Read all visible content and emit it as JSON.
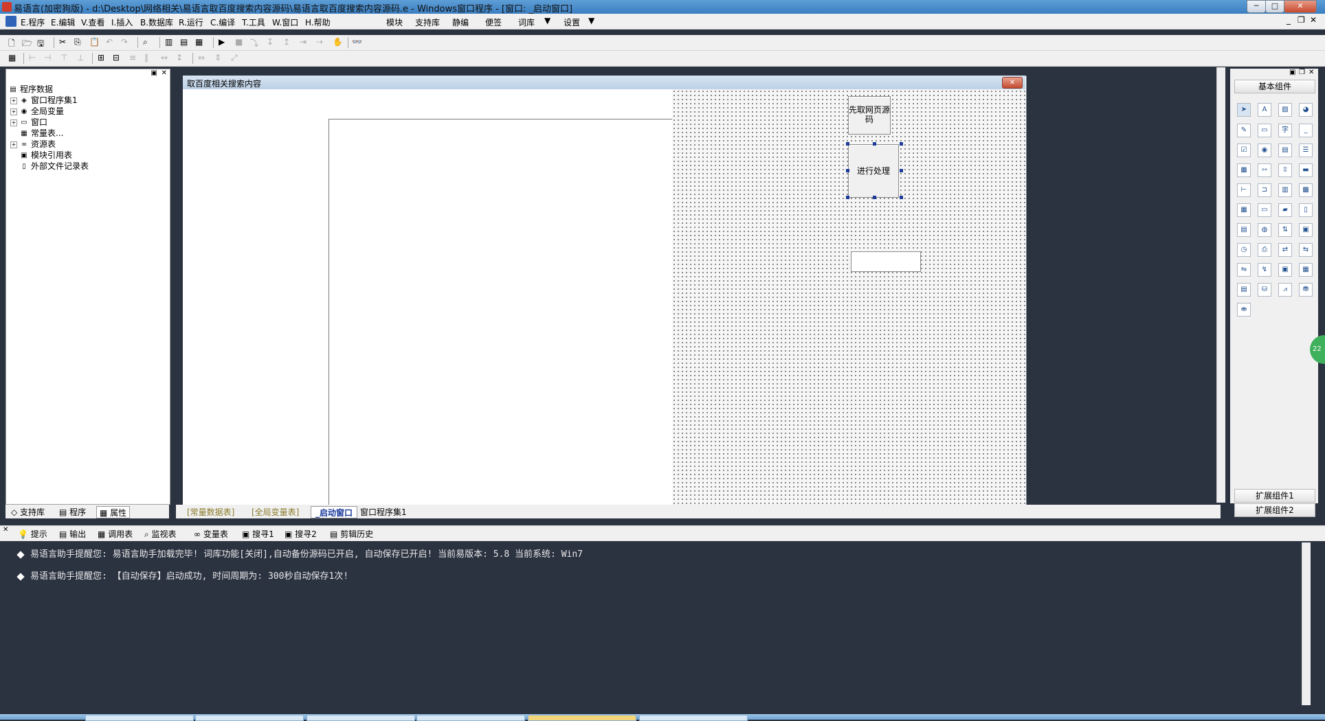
{
  "titlebar": {
    "title": "易语言(加密狗版) - d:\\Desktop\\网络相关\\易语言取百度搜索内容源码\\易语言取百度搜索内容源码.e - Windows窗口程序 - [窗口: _启动窗口]",
    "minimize": "─",
    "maximize": "□",
    "close": "✕"
  },
  "menubar": {
    "items": [
      "E.程序",
      "E.编辑",
      "V.查看",
      "I.插入",
      "B.数据库",
      "R.运行",
      "C.编译",
      "T.工具",
      "W.窗口",
      "H.帮助"
    ],
    "extras": [
      "模块",
      "支持库",
      "静编",
      "便签",
      "词库",
      "设置"
    ]
  },
  "left_panel": {
    "tree": [
      {
        "label": "程序数据",
        "expand": ""
      },
      {
        "label": "窗口程序集1",
        "expand": "+"
      },
      {
        "label": "全局变量",
        "expand": "+"
      },
      {
        "label": "窗口",
        "expand": "+"
      },
      {
        "label": "常量表...",
        "expand": ""
      },
      {
        "label": "资源表",
        "expand": "+"
      },
      {
        "label": "模块引用表",
        "expand": ""
      },
      {
        "label": "外部文件记录表",
        "expand": ""
      }
    ],
    "tabs": [
      "支持库",
      "程序",
      "属性"
    ]
  },
  "design": {
    "window_title": "取百度相关搜索内容",
    "button1": "先取网页源码",
    "button2": "进行处理",
    "tabs": [
      "[常量数据表]",
      "[全局变量表]",
      "_启动窗口",
      "窗口程序集1"
    ]
  },
  "right_panel": {
    "header": "基本组件",
    "ext1": "扩展组件1",
    "ext2": "扩展组件2",
    "side_badge": "22"
  },
  "output_tabs": [
    "提示",
    "输出",
    "调用表",
    "监视表",
    "变量表",
    "搜寻1",
    "搜寻2",
    "剪辑历史"
  ],
  "output": {
    "lines": [
      "易语言助手提醒您:  易语言助手加载完毕! 词库功能[关闭],自动备份源码已开启, 自动保存已开启! 当前易版本: 5.8  当前系统: Win7",
      "易语言助手提醒您: 【自动保存】启动成功, 时间周期为: 300秒自动保存1次!"
    ]
  },
  "colors": {
    "accent": "#3b7fc2",
    "output_bg": "#2b3240",
    "handle": "#1b3a9a"
  }
}
